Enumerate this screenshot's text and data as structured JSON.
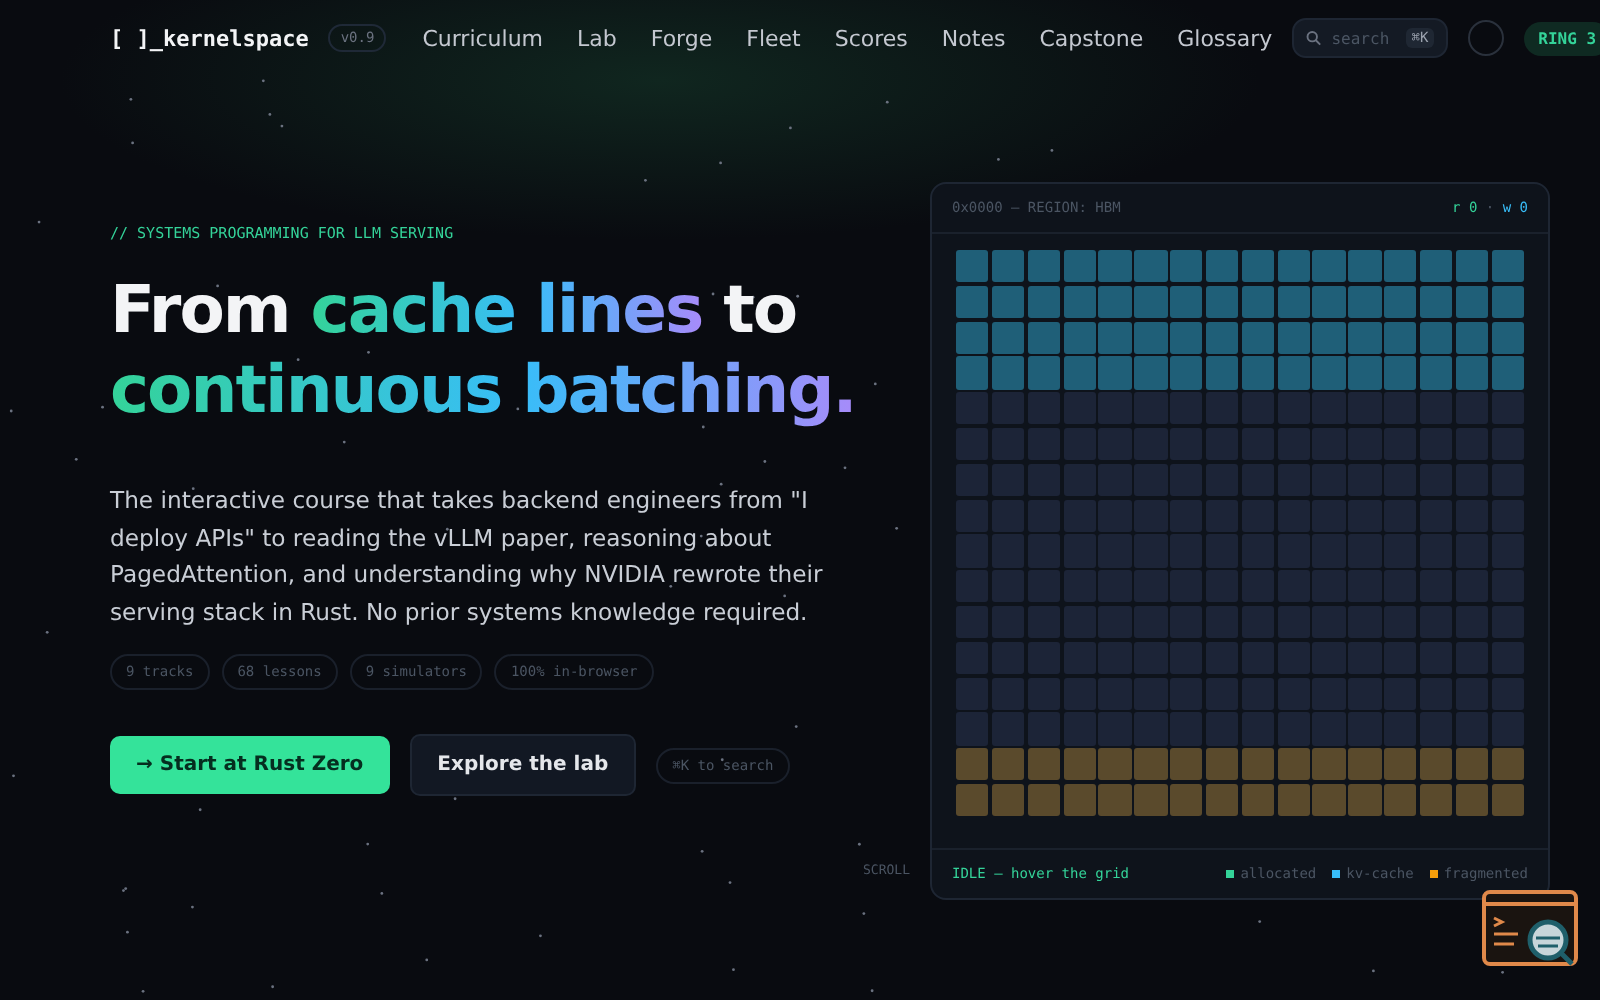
{
  "nav": {
    "logo": "[ ]_kernelspace",
    "version": "v0.9",
    "links": [
      "Curriculum",
      "Lab",
      "Forge",
      "Fleet",
      "Scores",
      "Notes",
      "Capstone",
      "Glossary"
    ],
    "search": {
      "placeholder": "search",
      "shortcut": "⌘K"
    },
    "ring": "RING 3"
  },
  "hero": {
    "eyebrow": "// SYSTEMS PROGRAMMING FOR LLM SERVING",
    "headline": [
      {
        "text": "From ",
        "kind": "plain"
      },
      {
        "text": "cache lines",
        "kind": "gradient"
      },
      {
        "text": " to ",
        "kind": "plain"
      },
      {
        "text": "continuous batching.",
        "kind": "gradient"
      }
    ],
    "description": "The interactive course that takes backend engineers from \"I deploy APIs\" to reading the vLLM paper, reasoning about PagedAttention, and understanding why NVIDIA rewrote their serving stack in Rust. No prior systems knowledge required.",
    "stats": [
      "9 tracks",
      "68 lessons",
      "9 simulators",
      "100% in-browser"
    ],
    "primary_button": "→ Start at Rust Zero",
    "secondary_button": "Explore the lab",
    "search_hint": "⌘K to search",
    "scroll": "SCROLL"
  },
  "memory_panel": {
    "title": "0x0000 — REGION: HBM",
    "counters": [
      {
        "text": "r 0",
        "color": "#34d399"
      },
      {
        "text": " · ",
        "color": "#4b5563"
      },
      {
        "text": "w 0",
        "color": "#38bdf8"
      }
    ],
    "grid_rows": [
      {
        "kind": "kv-cache"
      },
      {
        "kind": "kv-cache"
      },
      {
        "kind": "kv-cache"
      },
      {
        "kind": "kv-cache"
      },
      {
        "kind": "free"
      },
      {
        "kind": "free"
      },
      {
        "kind": "free"
      },
      {
        "kind": "free"
      },
      {
        "kind": "free"
      },
      {
        "kind": "free"
      },
      {
        "kind": "free"
      },
      {
        "kind": "free"
      },
      {
        "kind": "free"
      },
      {
        "kind": "free"
      },
      {
        "kind": "fragmented"
      },
      {
        "kind": "fragmented"
      }
    ],
    "status": "IDLE — hover the grid",
    "legend": [
      {
        "label": "allocated",
        "color": "#34d399"
      },
      {
        "label": "kv-cache",
        "color": "#38bdf8"
      },
      {
        "label": "fragmented",
        "color": "#f59e0b"
      }
    ]
  }
}
